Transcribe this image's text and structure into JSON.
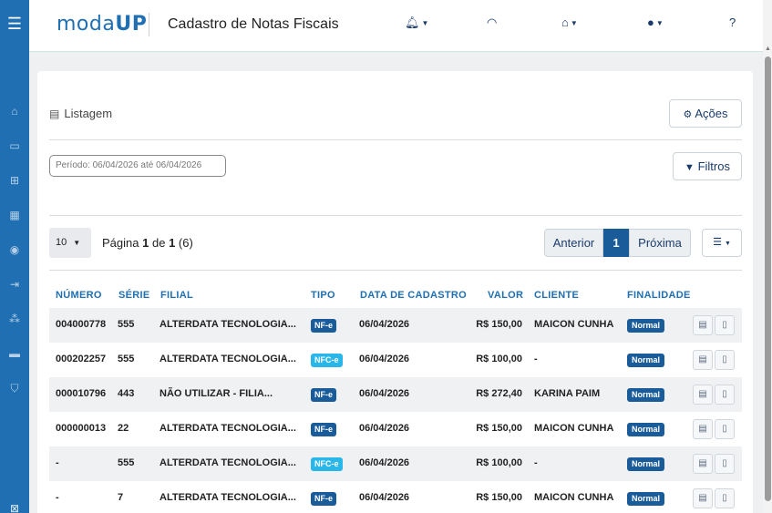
{
  "app": {
    "logo_prefix": "moda",
    "logo_suffix": "UP",
    "page_title": "Cadastro de Notas Fiscais"
  },
  "header_icons": [
    "bell-icon",
    "wifi-icon",
    "store-icon",
    "user-icon",
    "help-icon"
  ],
  "sidebar_icons": [
    "home-icon",
    "store-icon",
    "sitemap-icon",
    "boxes-icon",
    "coins-icon",
    "exit-icon",
    "network-icon",
    "cart-icon",
    "shield-icon"
  ],
  "card": {
    "listagem_label": "Listagem",
    "acoes_label": "Ações",
    "filtros_label": "Filtros",
    "periodo_text": "Período: 06/04/2026 até 06/04/2026"
  },
  "pagination": {
    "page_size": "10",
    "page_label": "Página",
    "page_current": "1",
    "page_of": "de",
    "page_total": "1",
    "record_count": "(6)",
    "prev_label": "Anterior",
    "current_page": "1",
    "next_label": "Próxima"
  },
  "table": {
    "headers": {
      "numero": "NÚMERO",
      "serie": "SÉRIE",
      "filial": "FILIAL",
      "tipo": "TIPO",
      "data": "DATA DE CADASTRO",
      "valor": "VALOR",
      "cliente": "CLIENTE",
      "finalidade": "FINALIDADE"
    },
    "rows": [
      {
        "numero": "004000778",
        "serie": "555",
        "filial": "ALTERDATA TECNOLOGIA...",
        "tipo": "NF-e",
        "data": "06/04/2026",
        "valor": "R$ 150,00",
        "cliente": "MAICON CUNHA",
        "finalidade": "Normal"
      },
      {
        "numero": "000202257",
        "serie": "555",
        "filial": "ALTERDATA TECNOLOGIA...",
        "tipo": "NFC-e",
        "data": "06/04/2026",
        "valor": "R$ 100,00",
        "cliente": "-",
        "finalidade": "Normal"
      },
      {
        "numero": "000010796",
        "serie": "443",
        "filial": "NÃO UTILIZAR - FILIA...",
        "tipo": "NF-e",
        "data": "06/04/2026",
        "valor": "R$ 272,40",
        "cliente": "KARINA PAIM",
        "finalidade": "Normal"
      },
      {
        "numero": "000000013",
        "serie": "22",
        "filial": "ALTERDATA TECNOLOGIA...",
        "tipo": "NF-e",
        "data": "06/04/2026",
        "valor": "R$ 150,00",
        "cliente": "MAICON CUNHA",
        "finalidade": "Normal"
      },
      {
        "numero": "-",
        "serie": "555",
        "filial": "ALTERDATA TECNOLOGIA...",
        "tipo": "NFC-e",
        "data": "06/04/2026",
        "valor": "R$ 100,00",
        "cliente": "-",
        "finalidade": "Normal"
      },
      {
        "numero": "-",
        "serie": "7",
        "filial": "ALTERDATA TECNOLOGIA...",
        "tipo": "NF-e",
        "data": "06/04/2026",
        "valor": "R$ 150,00",
        "cliente": "MAICON CUNHA",
        "finalidade": "Normal"
      }
    ]
  },
  "colors": {
    "brand": "#1f6fb2",
    "nfe_badge": "#1a5c99",
    "nfce_badge": "#29b6e8",
    "finalidade_badge": "#1a5c99"
  }
}
